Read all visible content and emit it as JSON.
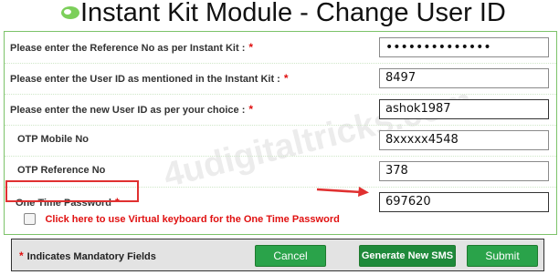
{
  "title": "Instant Kit Module - Change User ID",
  "colors": {
    "accent": "#2aa34a",
    "required": "#e01010",
    "highlight": "#e03030"
  },
  "form": {
    "reference_label": "Please enter the Reference No as per Instant Kit :",
    "reference_value": "••••••••••••••",
    "userid_label": "Please enter the User ID as mentioned in the Instant Kit :",
    "userid_value": "8497",
    "new_userid_label": "Please enter the new User ID as per your choice :",
    "new_userid_value": "ashok1987",
    "otp_mobile_label": "OTP Mobile No",
    "otp_mobile_value": "8xxxxx4548",
    "otp_ref_label": "OTP Reference No",
    "otp_ref_value": "378",
    "otp_label": "One Time Password",
    "otp_value": "697620",
    "required_mark": "*"
  },
  "virtual_keyboard": {
    "label": "Click here to use Virtual keyboard for the One Time Password",
    "checked": false
  },
  "footer": {
    "note": "Indicates Mandatory Fields",
    "cancel_label": "Cancel",
    "generate_label": "Generate New SMS",
    "submit_label": "Submit"
  },
  "watermark": "4udigitaltricks.com"
}
